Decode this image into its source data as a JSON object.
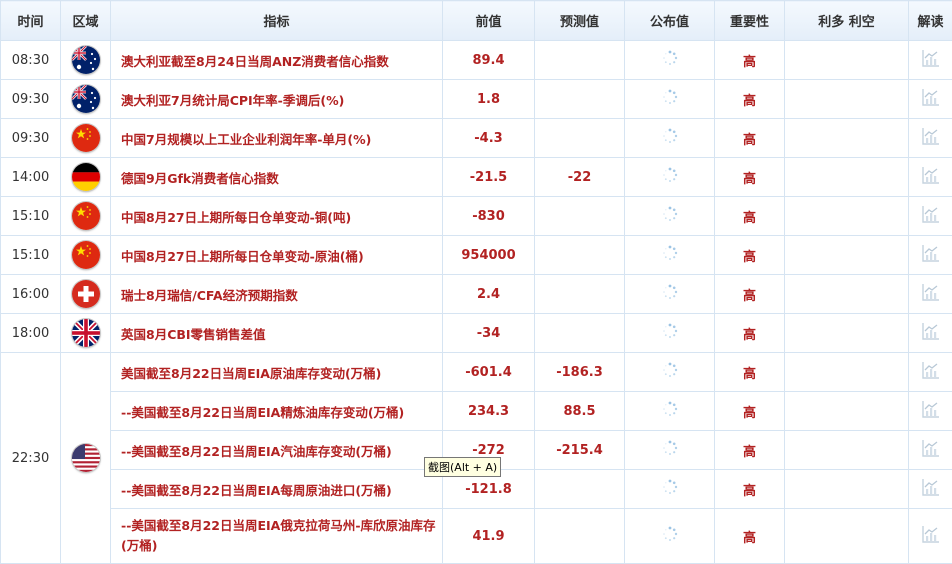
{
  "headers": {
    "time": "时间",
    "region": "区域",
    "indicator": "指标",
    "previous": "前值",
    "forecast": "预测值",
    "actual": "公布值",
    "importance": "重要性",
    "impact": "利多 利空",
    "interpret": "解读"
  },
  "rows": [
    {
      "time": "08:30",
      "flag": "australia-flag",
      "name": "澳大利亚截至8月24日当周ANZ消费者信心指数",
      "previous": "89.4",
      "forecast": "",
      "importance": "高"
    },
    {
      "time": "09:30",
      "flag": "australia-flag",
      "name": "澳大利亚7月统计局CPI年率-季调后(%)",
      "previous": "1.8",
      "forecast": "",
      "importance": "高"
    },
    {
      "time": "09:30",
      "flag": "china-flag",
      "name": "中国7月规模以上工业企业利润年率-单月(%)",
      "previous": "-4.3",
      "forecast": "",
      "importance": "高"
    },
    {
      "time": "14:00",
      "flag": "germany-flag",
      "name": "德国9月Gfk消费者信心指数",
      "previous": "-21.5",
      "forecast": "-22",
      "importance": "高"
    },
    {
      "time": "15:10",
      "flag": "china-flag",
      "name": "中国8月27日上期所每日仓单变动-铜(吨)",
      "previous": "-830",
      "forecast": "",
      "importance": "高"
    },
    {
      "time": "15:10",
      "flag": "china-flag",
      "name": "中国8月27日上期所每日仓单变动-原油(桶)",
      "previous": "954000",
      "forecast": "",
      "importance": "高"
    },
    {
      "time": "16:00",
      "flag": "switzerland-flag",
      "name": "瑞士8月瑞信/CFA经济预期指数",
      "previous": "2.4",
      "forecast": "",
      "importance": "高"
    },
    {
      "time": "18:00",
      "flag": "uk-flag",
      "name": "英国8月CBI零售销售差值",
      "previous": "-34",
      "forecast": "",
      "importance": "高"
    }
  ],
  "us_group": {
    "time": "22:30",
    "flag": "usa-flag",
    "rows": [
      {
        "name": "美国截至8月22日当周EIA原油库存变动(万桶)",
        "previous": "-601.4",
        "forecast": "-186.3",
        "importance": "高"
      },
      {
        "name": "--美国截至8月22日当周EIA精炼油库存变动(万桶)",
        "previous": "234.3",
        "forecast": "88.5",
        "importance": "高"
      },
      {
        "name": "--美国截至8月22日当周EIA汽油库存变动(万桶)",
        "previous": "-272",
        "forecast": "-215.4",
        "importance": "高"
      },
      {
        "name": "--美国截至8月22日当周EIA每周原油进口(万桶)",
        "previous": "-121.8",
        "forecast": "",
        "importance": "高"
      },
      {
        "name": "--美国截至8月22日当周EIA俄克拉荷马州-库欣原油库存(万桶)",
        "previous": "41.9",
        "forecast": "",
        "importance": "高"
      }
    ]
  },
  "tooltip": "截图(Alt + A)",
  "colors": {
    "accent": "#b22222",
    "border": "#d6e4f2",
    "header_bg": "#e4eef9"
  }
}
